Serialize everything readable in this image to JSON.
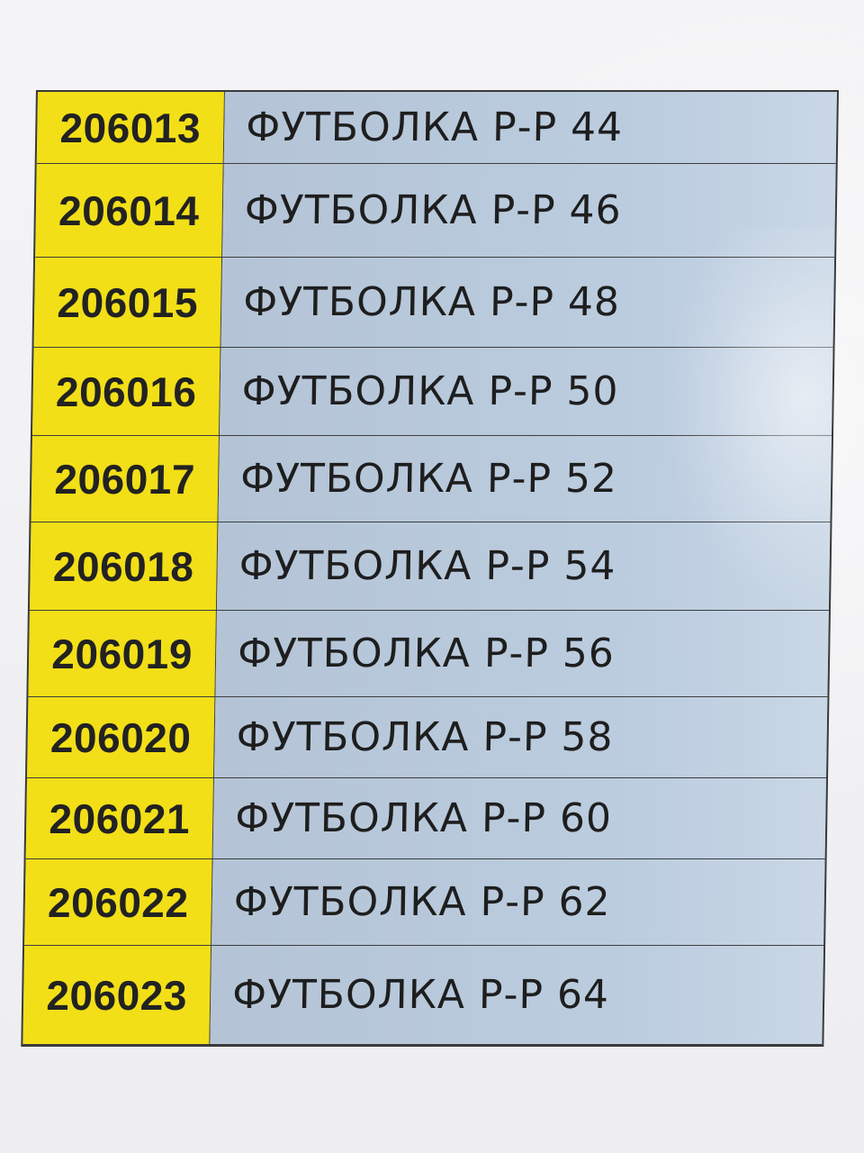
{
  "table": {
    "rows": [
      {
        "code": "206013",
        "name": "ФУТБОЛКА Р-Р 44"
      },
      {
        "code": "206014",
        "name": "ФУТБОЛКА Р-Р 46"
      },
      {
        "code": "206015",
        "name": "ФУТБОЛКА Р-Р 48"
      },
      {
        "code": "206016",
        "name": "ФУТБОЛКА Р-Р 50"
      },
      {
        "code": "206017",
        "name": "ФУТБОЛКА Р-Р 52"
      },
      {
        "code": "206018",
        "name": "ФУТБОЛКА Р-Р 54"
      },
      {
        "code": "206019",
        "name": "ФУТБОЛКА Р-Р 56"
      },
      {
        "code": "206020",
        "name": "ФУТБОЛКА Р-Р 58"
      },
      {
        "code": "206021",
        "name": "ФУТБОЛКА Р-Р 60"
      },
      {
        "code": "206022",
        "name": "ФУТБОЛКА Р-Р 62"
      },
      {
        "code": "206023",
        "name": "ФУТБОЛКА Р-Р 64"
      }
    ]
  },
  "colors": {
    "code_background": "#f2df17",
    "name_background": "#b9cadc",
    "text": "#1e1e1e",
    "grid_lines": "#3d3d3d"
  }
}
